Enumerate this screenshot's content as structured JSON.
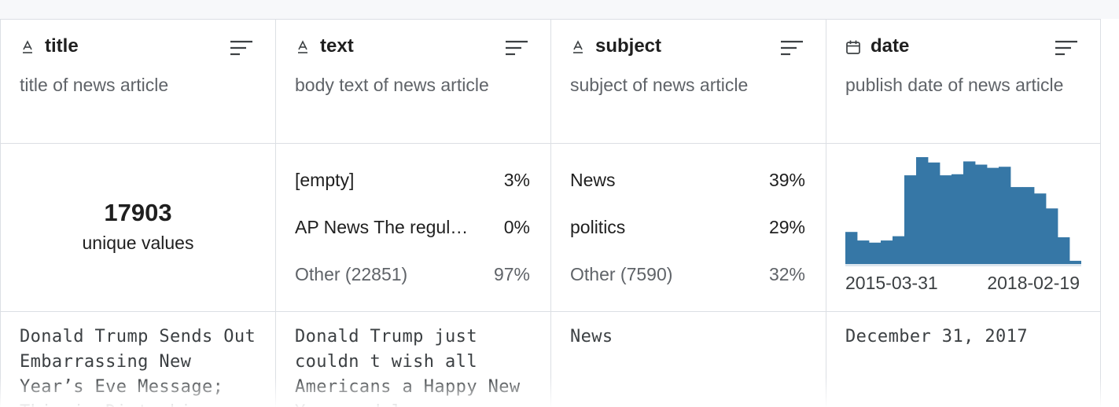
{
  "columns": [
    {
      "name": "title",
      "type_icon": "text-type-icon",
      "description": "title of news article",
      "stats": {
        "kind": "unique",
        "count": "17903",
        "label": "unique values"
      },
      "sample": "Donald Trump Sends Out Embarrassing New Year’s Eve Message; This is Disturbing"
    },
    {
      "name": "text",
      "type_icon": "text-type-icon",
      "description": "body text of news article",
      "stats": {
        "kind": "frequency",
        "rows": [
          {
            "label": "[empty]",
            "pct": "3%"
          },
          {
            "label": "AP News The regul…",
            "pct": "0%"
          },
          {
            "label": "Other (22851)",
            "pct": "97%"
          }
        ]
      },
      "sample": "Donald Trump just couldn t wish all Americans a Happy New Year and leave"
    },
    {
      "name": "subject",
      "type_icon": "text-type-icon",
      "description": "subject of news article",
      "stats": {
        "kind": "frequency",
        "rows": [
          {
            "label": "News",
            "pct": "39%"
          },
          {
            "label": "politics",
            "pct": "29%"
          },
          {
            "label": "Other (7590)",
            "pct": "32%"
          }
        ]
      },
      "sample": "News"
    },
    {
      "name": "date",
      "type_icon": "calendar-icon",
      "description": "publish date of news article",
      "stats": {
        "kind": "histogram",
        "min_label": "2015-03-31",
        "max_label": "2018-02-19"
      },
      "sample": "December 31, 2017"
    }
  ],
  "chart_data": {
    "type": "bar",
    "values": [
      30,
      22,
      20,
      22,
      26,
      83,
      100,
      95,
      83,
      84,
      96,
      93,
      90,
      91,
      72,
      72,
      66,
      52,
      25,
      3
    ],
    "color": "#3677a6",
    "xlabel_min": "2015-03-31",
    "xlabel_max": "2018-02-19"
  },
  "colors": {
    "border": "#dcdfe4",
    "bar": "#3677a6",
    "muted_text": "#5f6368"
  }
}
